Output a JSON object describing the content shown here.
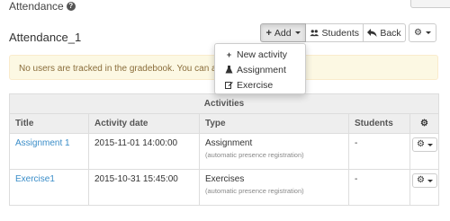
{
  "page": {
    "title": "Attendance",
    "help_icon": "question-circle-icon"
  },
  "section": {
    "title": "Attendance_1"
  },
  "toolbar": {
    "add_label": "Add",
    "students_label": "Students",
    "back_label": "Back"
  },
  "dropdown": {
    "items": [
      {
        "label": "New activity",
        "icon": "plus-icon"
      },
      {
        "label": "Assignment",
        "icon": "flask-icon"
      },
      {
        "label": "Exercise",
        "icon": "edit-icon"
      }
    ]
  },
  "alert": {
    "text": "No users are tracked in the gradebook. You can add"
  },
  "table": {
    "group_header": "Activities",
    "columns": [
      "Title",
      "Activity date",
      "Type",
      "Students",
      ""
    ],
    "rows": [
      {
        "title": "Assignment 1",
        "date": "2015-11-01 14:00:00",
        "type": "Assignment",
        "type_note": "(automatic presence registration)",
        "students": "-"
      },
      {
        "title": "Exercise1",
        "date": "2015-10-31 15:45:00",
        "type": "Exercises",
        "type_note": "(automatic presence registration)",
        "students": "-"
      }
    ]
  },
  "colors": {
    "link": "#3a8dc8",
    "alert_bg": "#fcf8e3",
    "alert_text": "#8a6d3b"
  }
}
